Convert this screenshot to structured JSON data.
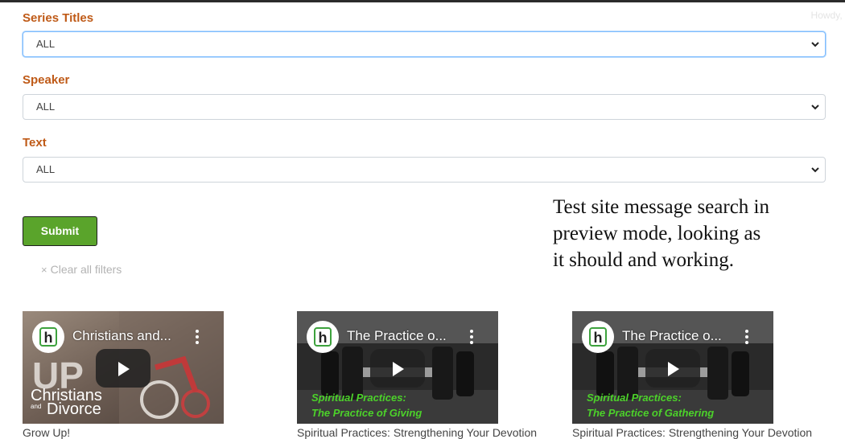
{
  "header": {
    "howdy_text": "Howdy, J"
  },
  "filters": {
    "series_label": "Series Titles",
    "series_value": "ALL",
    "speaker_label": "Speaker",
    "speaker_value": "ALL",
    "text_label": "Text",
    "text_value": "ALL",
    "submit_label": "Submit",
    "clear_label": "Clear all filters",
    "clear_icon": "×"
  },
  "note": {
    "line1": "Test site message search in",
    "line2": "preview mode, looking as",
    "line3": "it should and working."
  },
  "videos": [
    {
      "title": "Christians and...",
      "caption": "Grow Up!",
      "art_text_top": "UP",
      "art_text_main": "Christians",
      "art_text_small": "and",
      "art_text_bottom": "Divorce"
    },
    {
      "title": "The Practice o...",
      "caption": "Spiritual Practices: Strengthening Your Devotion",
      "art_line1": "Spiritual Practices:",
      "art_line2": "The Practice of Giving"
    },
    {
      "title": "The Practice o...",
      "caption": "Spiritual Practices: Strengthening Your Devotion",
      "art_line1": "Spiritual Practices:",
      "art_line2": "The Practice of Gathering"
    }
  ],
  "colors": {
    "label": "#bf5a17",
    "submit_bg": "#5aa42b",
    "art_green": "#4cd22a",
    "focus_border": "#80bdff"
  },
  "icons": {
    "select_arrow": "chevron-down-icon",
    "channel_logo": "h-logo-icon",
    "more": "more-vertical-icon",
    "play": "play-icon",
    "clear": "close-icon"
  }
}
